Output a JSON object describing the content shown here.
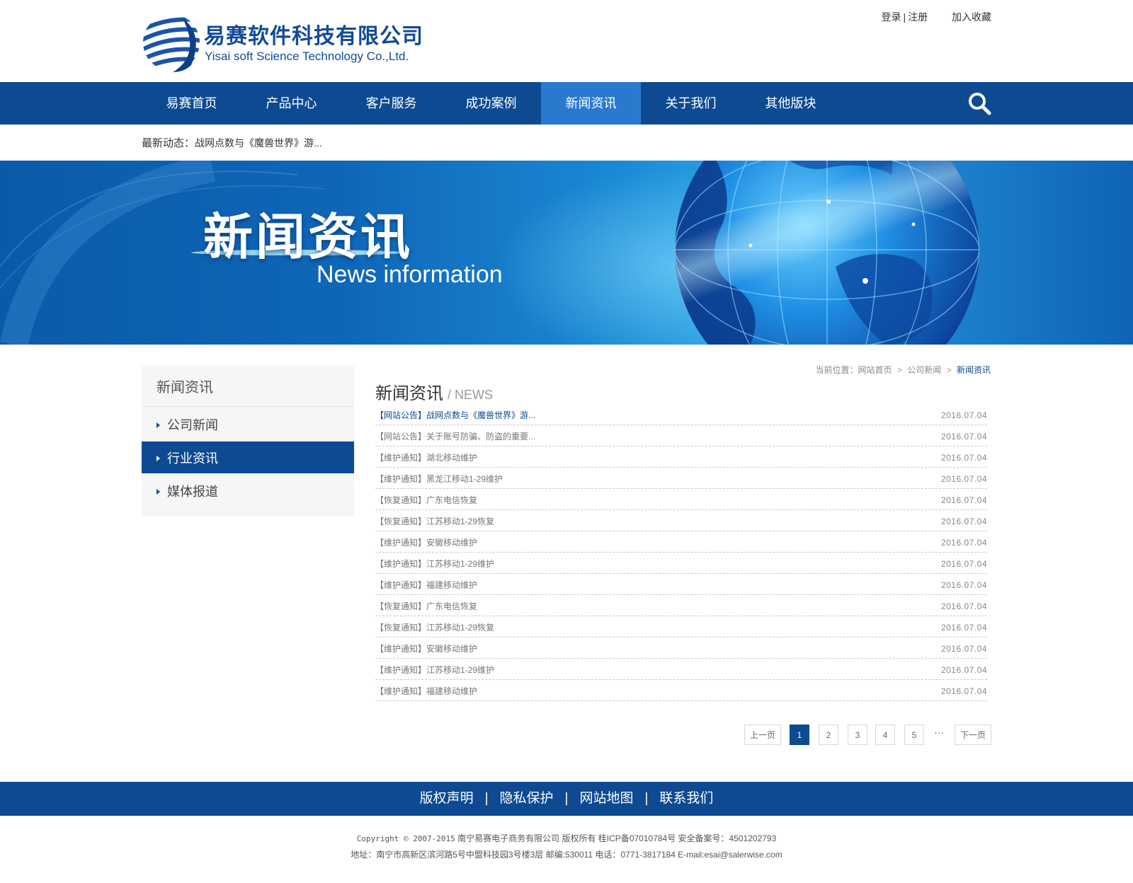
{
  "header": {
    "logo_cn": "易赛软件科技有限公司",
    "logo_en": "Yisai soft Science Technology Co.,Ltd.",
    "login": "登录",
    "separator": "|",
    "register": "注册",
    "favorite": "加入收藏"
  },
  "nav": {
    "items": [
      {
        "label": "易赛首页"
      },
      {
        "label": "产品中心"
      },
      {
        "label": "客户服务"
      },
      {
        "label": "成功案例"
      },
      {
        "label": "新闻资讯"
      },
      {
        "label": "关于我们"
      },
      {
        "label": "其他版块"
      }
    ],
    "active_index": 4,
    "search_icon": "search-icon"
  },
  "ticker": {
    "label": "最新动态：",
    "news": "战网点数与《魔兽世界》游..."
  },
  "banner": {
    "title_cn": "新闻资讯",
    "title_en": "News information"
  },
  "sidebar": {
    "title": "新闻资讯",
    "items": [
      {
        "label": "公司新闻"
      },
      {
        "label": "行业资讯"
      },
      {
        "label": "媒体报道"
      }
    ],
    "active_index": 1
  },
  "breadcrumb": {
    "prefix": "当前位置：",
    "items": [
      "网站首页",
      "公司新闻",
      "新闻资讯"
    ]
  },
  "section": {
    "title_cn": "新闻资讯",
    "title_en": "/ NEWS"
  },
  "news": [
    {
      "tag": "【网站公告】",
      "title": "战网点数与《魔兽世界》游...",
      "date": "2016.07.04"
    },
    {
      "tag": "【网站公告】",
      "title": "关于账号防骗、防盗的重要...",
      "date": "2016.07.04"
    },
    {
      "tag": "【维护通知】",
      "title": "湖北移动维护",
      "date": "2016.07.04"
    },
    {
      "tag": "【维护通知】",
      "title": "黑龙江移动1-29维护",
      "date": "2016.07.04"
    },
    {
      "tag": "【恢复通知】",
      "title": "广东电信恢复",
      "date": "2016.07.04"
    },
    {
      "tag": "【恢复通知】",
      "title": "江苏移动1-29恢复",
      "date": "2016.07.04"
    },
    {
      "tag": "【维护通知】",
      "title": "安徽移动维护",
      "date": "2016.07.04"
    },
    {
      "tag": "【维护通知】",
      "title": "江苏移动1-29维护",
      "date": "2016.07.04"
    },
    {
      "tag": "【维护通知】",
      "title": "福建移动维护",
      "date": "2016.07.04"
    },
    {
      "tag": "【恢复通知】",
      "title": "广东电信恢复",
      "date": "2016.07.04"
    },
    {
      "tag": "【恢复通知】",
      "title": "江苏移动1-29恢复",
      "date": "2016.07.04"
    },
    {
      "tag": "【维护通知】",
      "title": "安徽移动维护",
      "date": "2016.07.04"
    },
    {
      "tag": "【维护通知】",
      "title": "江苏移动1-29维护",
      "date": "2016.07.04"
    },
    {
      "tag": "【维护通知】",
      "title": "福建移动维护",
      "date": "2016.07.04"
    }
  ],
  "pager": {
    "prev": "上一页",
    "pages": [
      "1",
      "2",
      "3",
      "4",
      "5"
    ],
    "current": "1",
    "ellipsis": "···",
    "next": "下一页"
  },
  "footer": {
    "links": [
      "版权声明",
      "隐私保护",
      "网站地图",
      "联系我们"
    ],
    "separator": "|",
    "copyright_line1_prefix": "Copyright © 2007-2015",
    "copyright_line1": "南宁易赛电子商务有限公司 版权所有 桂ICP备07010784号 安全备案号：4501202793",
    "copyright_line2": "地址：南宁市高新区滨河路5号中盟科技园3号楼3层 邮编:530011 电话：0771-3817184 E-mail:esai@salerwise.com"
  },
  "colors": {
    "brand_blue": "#0d4a92",
    "nav_active": "#2a79cf",
    "banner_blue": "#0f66b7"
  }
}
